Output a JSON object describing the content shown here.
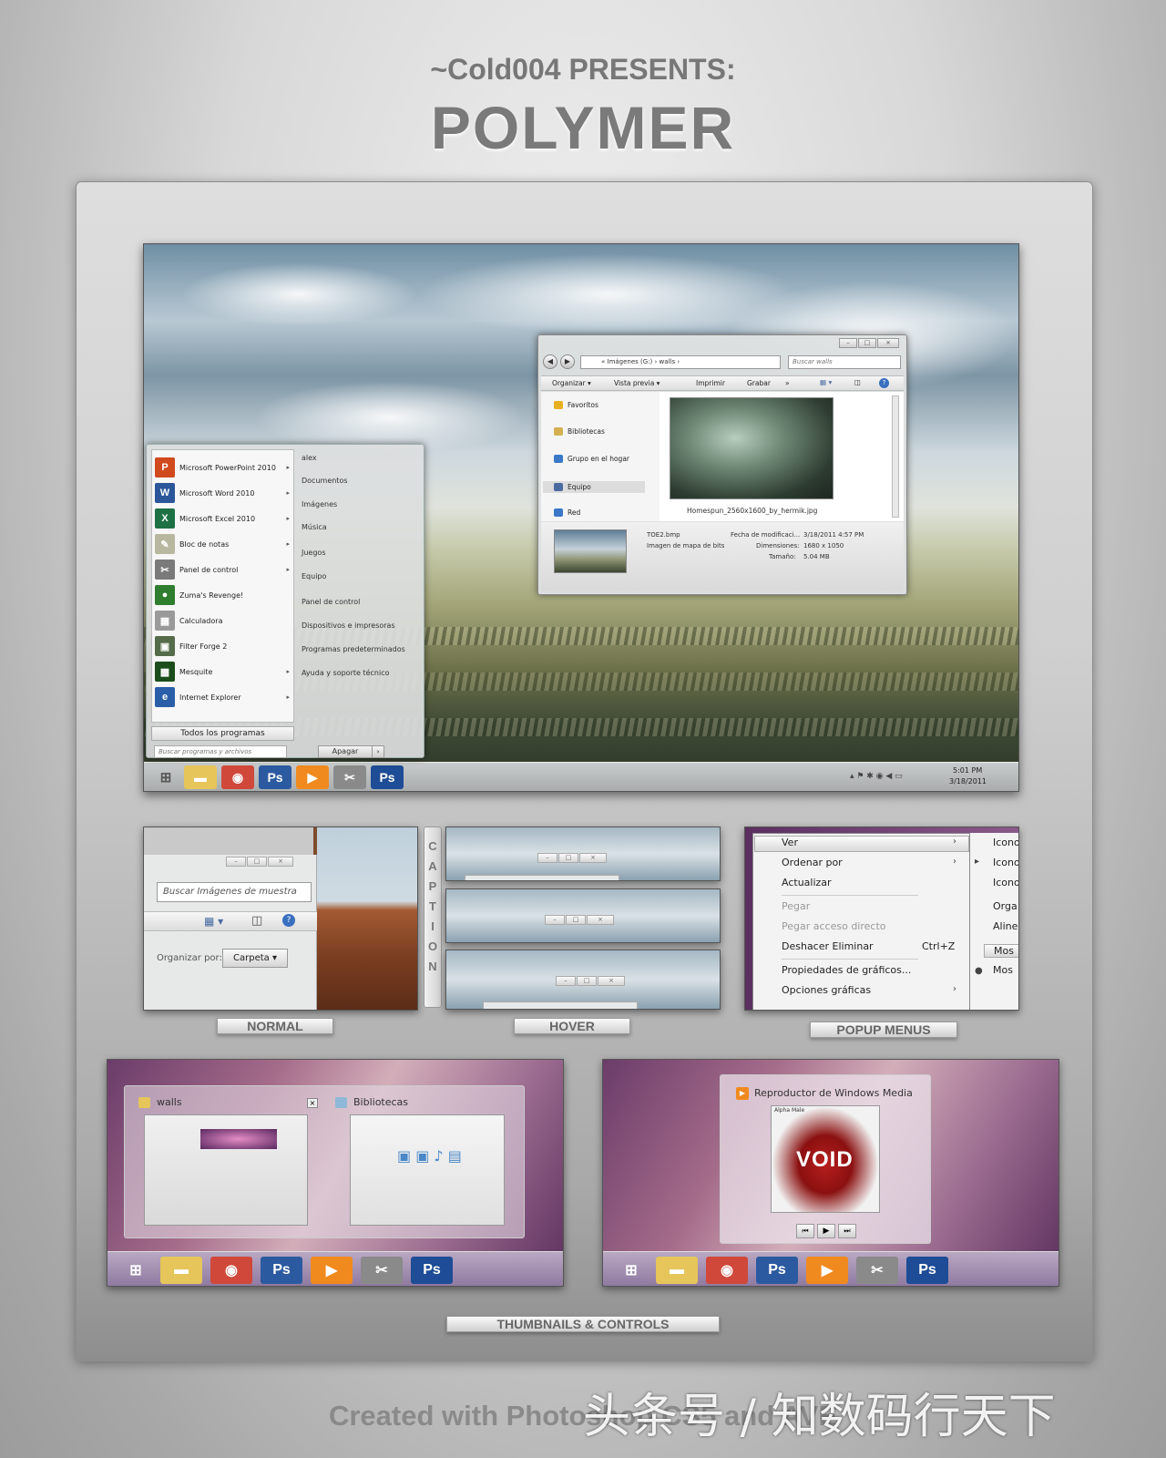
{
  "header": {
    "presents": "~Cold004 PRESENTS:",
    "title": "POLYMER"
  },
  "start_menu": {
    "programs": [
      {
        "label": "Microsoft PowerPoint 2010",
        "icon": "powerpoint-icon",
        "color": "#d04a1e",
        "glyph": "P",
        "arrow": true
      },
      {
        "label": "Microsoft Word 2010",
        "icon": "word-icon",
        "color": "#2b579a",
        "glyph": "W",
        "arrow": true
      },
      {
        "label": "Microsoft Excel 2010",
        "icon": "excel-icon",
        "color": "#1e7145",
        "glyph": "X",
        "arrow": true
      },
      {
        "label": "Bloc de notas",
        "icon": "notepad-icon",
        "color": "#b8b8a0",
        "glyph": "✎",
        "arrow": true
      },
      {
        "label": "Panel de control",
        "icon": "control-panel-icon",
        "color": "#7a7a7a",
        "glyph": "✂",
        "arrow": true
      },
      {
        "label": "Zuma's Revenge!",
        "icon": "zuma-icon",
        "color": "#2f7d2f",
        "glyph": "●",
        "arrow": false
      },
      {
        "label": "Calculadora",
        "icon": "calculator-icon",
        "color": "#9a9a9a",
        "glyph": "▦",
        "arrow": false
      },
      {
        "label": "Filter Forge 2",
        "icon": "filter-forge-icon",
        "color": "#556b4a",
        "glyph": "▣",
        "arrow": false
      },
      {
        "label": "Mesquite",
        "icon": "mesquite-icon",
        "color": "#1c4d1c",
        "glyph": "▩",
        "arrow": true
      },
      {
        "label": "Internet Explorer",
        "icon": "ie-icon",
        "color": "#2a5ea8",
        "glyph": "e",
        "arrow": true
      }
    ],
    "all_programs": "Todos los programas",
    "search_placeholder": "Buscar programas y archivos",
    "shutdown": "Apagar",
    "places": [
      "alex",
      "Documentos",
      "Imágenes",
      "Música",
      "Juegos",
      "Equipo",
      "Panel de control",
      "Dispositivos e impresoras",
      "Programas predeterminados",
      "Ayuda y soporte técnico"
    ]
  },
  "explorer": {
    "breadcrumb": "« Imágenes (G:) › walls ›",
    "search_placeholder": "Buscar walls",
    "toolbar": [
      "Organizar ▾",
      "Vista previa ▾",
      "Imprimir",
      "Grabar",
      "»"
    ],
    "nav": [
      {
        "label": "Favoritos",
        "icon": "star-icon",
        "color": "#e8b020"
      },
      {
        "label": "Bibliotecas",
        "icon": "library-icon",
        "color": "#d4b050"
      },
      {
        "label": "Grupo en el hogar",
        "icon": "homegroup-icon",
        "color": "#3a78c8"
      },
      {
        "label": "Equipo",
        "icon": "computer-icon",
        "color": "#4a6aa0"
      },
      {
        "label": "Red",
        "icon": "network-icon",
        "color": "#3a78c8"
      }
    ],
    "file_name": "Homespun_2560x1600_by_hermik.jpg",
    "details": {
      "name": "TOE2.bmp",
      "type": "Imagen de mapa de bits",
      "date_label": "Fecha de modificaci...",
      "date_value": "3/18/2011 4:57 PM",
      "dim_label": "Dimensiones:",
      "dim_value": "1680 x 1050",
      "size_label": "Tamaño:",
      "size_value": "5.04 MB"
    }
  },
  "taskbar": {
    "icons": [
      {
        "name": "folder-icon",
        "glyph": "▬",
        "color": "#e6c55a"
      },
      {
        "name": "chrome-icon",
        "glyph": "◉",
        "color": "#d0483a"
      },
      {
        "name": "photoshop-icon",
        "glyph": "Ps",
        "color": "#2c5aa0"
      },
      {
        "name": "media-player-icon",
        "glyph": "▶",
        "color": "#f08a1e"
      },
      {
        "name": "paint-icon",
        "glyph": "✂",
        "color": "#8a8a8a"
      },
      {
        "name": "photoshop-icon-2",
        "glyph": "Ps",
        "color": "#1e4c96"
      }
    ],
    "time": "5:01 PM",
    "date": "3/18/2011"
  },
  "normal": {
    "search_placeholder": "Buscar Imágenes de muestra",
    "organize_label": "Organizar por:",
    "organize_value": "Carpeta ▾"
  },
  "caption_letters": [
    "C",
    "A",
    "P",
    "T",
    "I",
    "O",
    "N"
  ],
  "popup": {
    "items": [
      {
        "label": "Ver",
        "disabled": false,
        "arrow": true,
        "shortcut": ""
      },
      {
        "label": "Ordenar por",
        "disabled": false,
        "arrow": true,
        "shortcut": ""
      },
      {
        "label": "Actualizar",
        "disabled": false,
        "arrow": false,
        "shortcut": ""
      },
      {
        "label": "Pegar",
        "disabled": true,
        "arrow": false,
        "shortcut": ""
      },
      {
        "label": "Pegar acceso directo",
        "disabled": true,
        "arrow": false,
        "shortcut": ""
      },
      {
        "label": "Deshacer Eliminar",
        "disabled": false,
        "arrow": false,
        "shortcut": "Ctrl+Z"
      },
      {
        "label": "Propiedades de gráficos...",
        "disabled": false,
        "arrow": false,
        "shortcut": ""
      },
      {
        "label": "Opciones gráficas",
        "disabled": false,
        "arrow": true,
        "shortcut": ""
      }
    ],
    "sub_items": [
      "Icono",
      "Icono",
      "Icono",
      "Orga",
      "Aline",
      "Mos",
      "Mos"
    ]
  },
  "labels": {
    "normal": "NORMAL",
    "hover": "HOVER",
    "popup": "POPUP MENUS",
    "thumbs": "THUMBNAILS & CONTROLS"
  },
  "thumbnails": {
    "walls": "walls",
    "bibliotecas": "Bibliotecas",
    "media_player": "Reproductor de Windows Media",
    "album_artist": "Alpha Male",
    "album_text": "VOID"
  },
  "credit": "Created with Photoshop CS5 and AVE",
  "watermark": "头条号 / 知数码行天下"
}
